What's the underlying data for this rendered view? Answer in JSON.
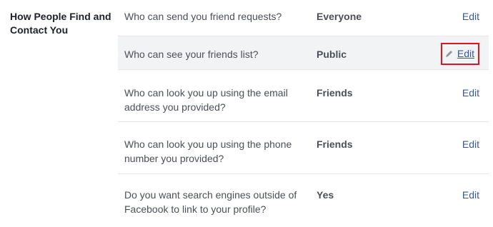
{
  "section": {
    "title": "How People Find and Contact You"
  },
  "rows": [
    {
      "question": "Who can send you friend requests?",
      "value": "Everyone",
      "edit": "Edit"
    },
    {
      "question": "Who can see your friends list?",
      "value": "Public",
      "edit": "Edit"
    },
    {
      "question": "Who can look you up using the email address you provided?",
      "value": "Friends",
      "edit": "Edit"
    },
    {
      "question": "Who can look you up using the phone number you provided?",
      "value": "Friends",
      "edit": "Edit"
    },
    {
      "question": "Do you want search engines outside of Facebook to link to your profile?",
      "value": "Yes",
      "edit": "Edit"
    }
  ],
  "icons": {
    "edit_icon": "pencil-icon"
  },
  "colors": {
    "link": "#365899",
    "highlight_box": "#e0141e",
    "row_highlight": "#f2f3f5"
  }
}
